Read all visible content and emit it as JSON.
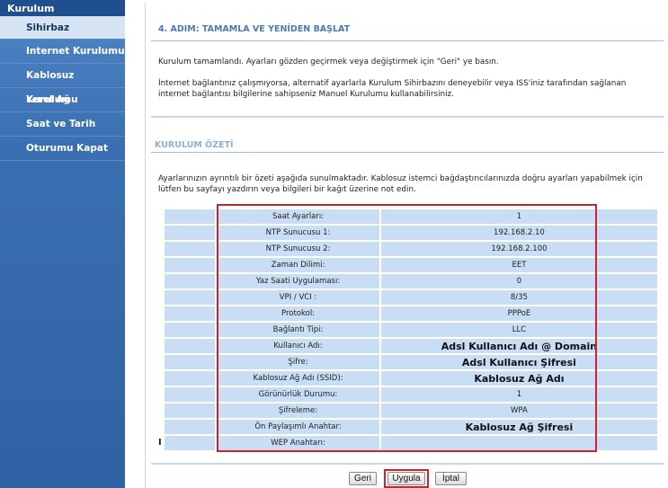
{
  "sidebar": {
    "header": "Kurulum",
    "items": [
      {
        "label": "Sihirbaz",
        "active": true
      },
      {
        "label": "Internet Kurulumu",
        "active": false
      },
      {
        "label": "Kablosuz Kurulumu",
        "active": false
      },
      {
        "label": "Yerel Ağ",
        "active": false
      },
      {
        "label": "Saat ve Tarih",
        "active": false
      },
      {
        "label": "Oturumu Kapat",
        "active": false
      }
    ]
  },
  "main": {
    "step_title": "4. ADIM: TAMAMLA VE YENİDEN BAŞLAT",
    "para1": "Kurulum tamamlandı. Ayarları gözden geçirmek veya değiştirmek için \"Geri\" ye basın.",
    "para2": "İnternet bağlantınız çalışmıyorsa, alternatif ayarlarla Kurulum Sihirbazını deneyebilir veya ISS'iniz tarafından sağlanan internet bağlantısı bilgilerine sahipseniz Manuel Kurulumu kullanabilirsiniz.",
    "summary_title": "KURULUM ÖZETİ",
    "summary_text": "Ayarlarınızın ayrıntılı bir özeti aşağıda sunulmaktadır. Kablosuz istemci bağdaştırıcılarınızda doğru ayarları yapabilmek için lütfen bu sayfayı yazdırın veya bilgileri bir kağıt üzerine not edin.",
    "side_mark": "I",
    "rows": [
      {
        "label": "Saat Ayarları:",
        "value": "1",
        "big": false
      },
      {
        "label": "NTP Sunucusu 1:",
        "value": "192.168.2.10",
        "big": false
      },
      {
        "label": "NTP Sunucusu 2:",
        "value": "192.168.2.100",
        "big": false
      },
      {
        "label": "Zaman Dilimi:",
        "value": "EET",
        "big": false
      },
      {
        "label": "Yaz Saati Uygulaması:",
        "value": "0",
        "big": false
      },
      {
        "label": "VPI / VCI :",
        "value": "8/35",
        "big": false
      },
      {
        "label": "Protokol:",
        "value": "PPPoE",
        "big": false
      },
      {
        "label": "Bağlantı Tipi:",
        "value": "LLC",
        "big": false
      },
      {
        "label": "Kullanıcı Adı:",
        "value": "Adsl Kullanıcı Adı @ Domain",
        "big": true
      },
      {
        "label": "Şifre:",
        "value": "Adsl Kullanıcı Şifresi",
        "big": true
      },
      {
        "label": "Kablosuz Ağ Adı (SSID):",
        "value": "Kablosuz Ağ Adı",
        "big": true
      },
      {
        "label": "Görünürlük Durumu:",
        "value": "1",
        "big": false
      },
      {
        "label": "Şifreleme:",
        "value": "WPA",
        "big": false
      },
      {
        "label": "Ön Paylaşımlı Anahtar:",
        "value": "Kablosuz Ağ Şifresi",
        "big": true
      },
      {
        "label": "WEP Anahtarı:",
        "value": "",
        "big": false
      }
    ]
  },
  "buttons": {
    "back": "Geri",
    "apply": "Uygula",
    "cancel": "İptal"
  },
  "colors": {
    "sidebar": "#3a6fb1",
    "active_item": "#d7e4f3",
    "table_cell": "#c9ddf4",
    "highlight": "#d0202a"
  }
}
